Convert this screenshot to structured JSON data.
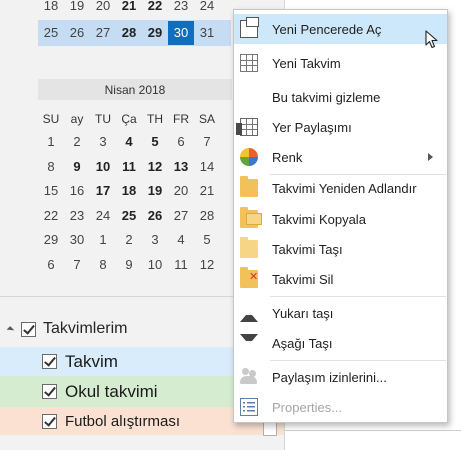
{
  "mini_calendar": {
    "prev_week_days": [
      {
        "d": "18",
        "bold": false
      },
      {
        "d": "19",
        "bold": false
      },
      {
        "d": "20",
        "bold": false
      },
      {
        "d": "21",
        "bold": true
      },
      {
        "d": "22",
        "bold": true
      },
      {
        "d": "23",
        "bold": false
      },
      {
        "d": "24",
        "bold": false
      }
    ],
    "current_week_days": [
      {
        "d": "25",
        "bold": false
      },
      {
        "d": "26",
        "bold": false
      },
      {
        "d": "27",
        "bold": false
      },
      {
        "d": "28",
        "bold": true
      },
      {
        "d": "29",
        "bold": true
      },
      {
        "d": "30",
        "bold": false,
        "today": true
      },
      {
        "d": "31",
        "bold": false
      }
    ],
    "month_title": "Nisan 2018",
    "weekdays": [
      "SU",
      "ay",
      "TU",
      "Ça",
      "TH",
      "FR",
      "SA"
    ],
    "april_rows": [
      [
        {
          "d": "1"
        },
        {
          "d": "2"
        },
        {
          "d": "3"
        },
        {
          "d": "4",
          "bold": true
        },
        {
          "d": "5",
          "bold": true
        },
        {
          "d": "6"
        },
        {
          "d": "7"
        }
      ],
      [
        {
          "d": "8"
        },
        {
          "d": "9",
          "bold": true
        },
        {
          "d": "10",
          "bold": true
        },
        {
          "d": "11",
          "bold": true
        },
        {
          "d": "12",
          "bold": true
        },
        {
          "d": "13",
          "bold": true
        },
        {
          "d": "14"
        }
      ],
      [
        {
          "d": "15"
        },
        {
          "d": "16"
        },
        {
          "d": "17",
          "bold": true
        },
        {
          "d": "18",
          "bold": true
        },
        {
          "d": "19",
          "bold": true
        },
        {
          "d": "20"
        },
        {
          "d": "21"
        }
      ],
      [
        {
          "d": "22"
        },
        {
          "d": "23"
        },
        {
          "d": "24"
        },
        {
          "d": "25",
          "bold": true
        },
        {
          "d": "26",
          "bold": true
        },
        {
          "d": "27"
        },
        {
          "d": "28"
        }
      ],
      [
        {
          "d": "29"
        },
        {
          "d": "30"
        },
        {
          "d": "1"
        },
        {
          "d": "2"
        },
        {
          "d": "3"
        },
        {
          "d": "4"
        },
        {
          "d": "5"
        }
      ],
      [
        {
          "d": "6"
        },
        {
          "d": "7"
        },
        {
          "d": "8"
        },
        {
          "d": "9"
        },
        {
          "d": "10"
        },
        {
          "d": "11"
        },
        {
          "d": "12"
        }
      ]
    ]
  },
  "calendars": {
    "group_label": "Takvimlerim",
    "items": [
      {
        "label": "Takvim",
        "checked": true,
        "color": "#d9ecfb"
      },
      {
        "label": "Okul takvimi",
        "checked": true,
        "color": "#d5ecd0"
      },
      {
        "label": "Futbol alıştırması",
        "checked": true,
        "color": "#fbe1d1"
      }
    ]
  },
  "context_menu": {
    "items": [
      {
        "label": "Yeni Pencerede Aç",
        "icon": "open-window-icon",
        "highlighted": true
      },
      {
        "label": "Yeni Takvim",
        "icon": "new-calendar-icon"
      },
      {
        "label": "Bu takvimi gizleme",
        "icon": "none"
      },
      {
        "label": "Yer Paylaşımı",
        "icon": "overlay-icon"
      },
      {
        "label": "Renk",
        "icon": "color-icon",
        "submenu": true
      },
      {
        "label": "Takvimi Yeniden Adlandır",
        "icon": "rename-folder-icon"
      },
      {
        "label": "Takvimi Kopyala",
        "icon": "copy-folder-icon"
      },
      {
        "label": "Takvimi Taşı",
        "icon": "move-folder-icon"
      },
      {
        "label": "Takvimi Sil",
        "icon": "delete-folder-icon"
      },
      {
        "label": "Yukarı taşı",
        "icon": "move-up-icon"
      },
      {
        "label": "Aşağı Taşı",
        "icon": "move-down-icon"
      },
      {
        "label": "Paylaşım izinlerini...",
        "icon": "sharing-permissions-icon"
      },
      {
        "label": "Properties...",
        "icon": "properties-icon",
        "disabled": true
      }
    ]
  },
  "colors": {
    "accent": "#106ebe",
    "week_highlight": "#c5dcf2",
    "menu_highlight": "#cde8fb"
  }
}
